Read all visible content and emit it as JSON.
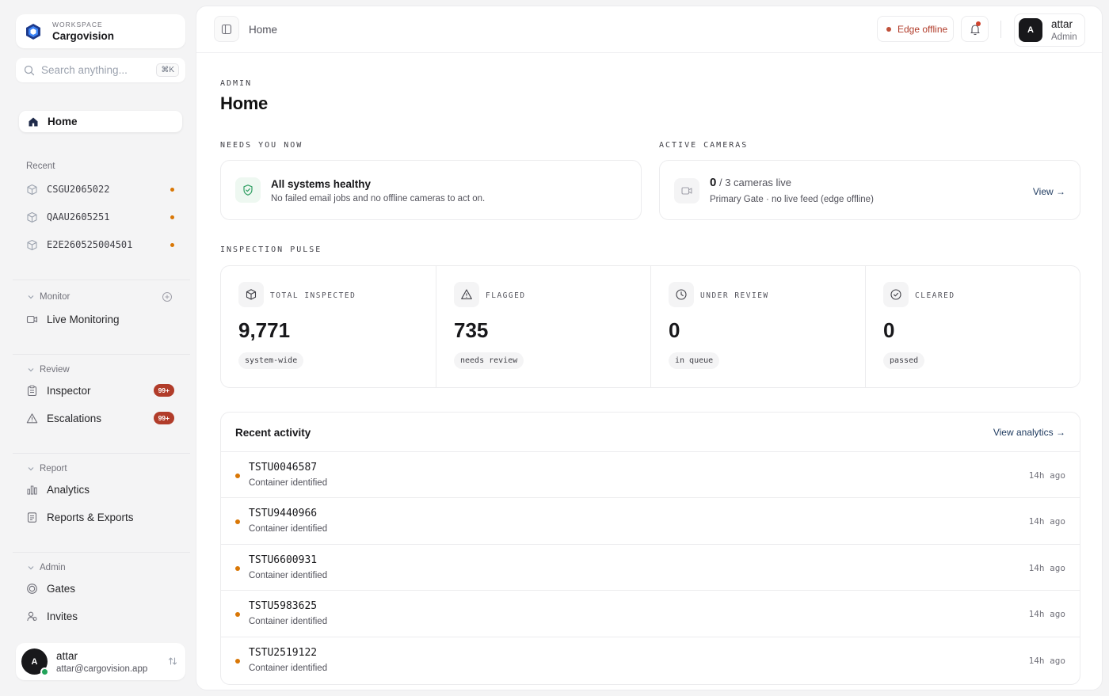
{
  "workspace": {
    "label": "WORKSPACE",
    "name": "Cargovision"
  },
  "search": {
    "placeholder": "Search anything...",
    "shortcut": "⌘K"
  },
  "sidebar": {
    "home_label": "Home",
    "recent_label": "Recent",
    "recent": [
      {
        "id": "CSGU2065022"
      },
      {
        "id": "QAAU2605251"
      },
      {
        "id": "E2E260525004501"
      }
    ],
    "groups": {
      "monitor": {
        "label": "Monitor",
        "items": [
          {
            "label": "Live Monitoring",
            "icon": "video-icon"
          }
        ]
      },
      "review": {
        "label": "Review",
        "items": [
          {
            "label": "Inspector",
            "icon": "clipboard-icon",
            "badge": "99+"
          },
          {
            "label": "Escalations",
            "icon": "warning-icon",
            "badge": "99+"
          }
        ]
      },
      "report": {
        "label": "Report",
        "items": [
          {
            "label": "Analytics",
            "icon": "bar-chart-icon"
          },
          {
            "label": "Reports & Exports",
            "icon": "document-icon"
          }
        ]
      },
      "admin": {
        "label": "Admin",
        "items": [
          {
            "label": "Gates",
            "icon": "gate-icon"
          },
          {
            "label": "Invites",
            "icon": "users-icon"
          }
        ]
      }
    }
  },
  "user": {
    "initial": "A",
    "name": "attar",
    "email": "attar@cargovision.app",
    "role": "Admin"
  },
  "topbar": {
    "breadcrumb": "Home",
    "edge_status": "Edge offline"
  },
  "page": {
    "eyebrow": "ADMIN",
    "title": "Home"
  },
  "needs_you_now": {
    "label": "NEEDS YOU NOW",
    "title": "All systems healthy",
    "subtitle": "No failed email jobs and no offline cameras to act on."
  },
  "active_cameras": {
    "label": "ACTIVE CAMERAS",
    "live_count": "0",
    "total_text": "/ 3 cameras live",
    "gate": "Primary Gate",
    "detail": "· no live feed (edge offline)",
    "link": "View →"
  },
  "inspection_pulse": {
    "label": "INSPECTION PULSE",
    "stats": [
      {
        "label": "TOTAL INSPECTED",
        "value": "9,771",
        "chip": "system-wide",
        "icon": "box-icon"
      },
      {
        "label": "FLAGGED",
        "value": "735",
        "chip": "needs review",
        "icon": "warning-icon"
      },
      {
        "label": "UNDER REVIEW",
        "value": "0",
        "chip": "in queue",
        "icon": "clock-icon"
      },
      {
        "label": "CLEARED",
        "value": "0",
        "chip": "passed",
        "icon": "check-circle-icon"
      }
    ]
  },
  "recent_activity": {
    "title": "Recent activity",
    "link": "View analytics →",
    "rows": [
      {
        "id": "TSTU0046587",
        "desc": "Container identified",
        "time": "14h ago"
      },
      {
        "id": "TSTU9440966",
        "desc": "Container identified",
        "time": "14h ago"
      },
      {
        "id": "TSTU6600931",
        "desc": "Container identified",
        "time": "14h ago"
      },
      {
        "id": "TSTU5983625",
        "desc": "Container identified",
        "time": "14h ago"
      },
      {
        "id": "TSTU2519122",
        "desc": "Container identified",
        "time": "14h ago"
      }
    ]
  },
  "colors": {
    "accent": "#1e3a5f",
    "danger": "#b13c2a",
    "warning_dot": "#d97706",
    "online": "#22a35a"
  }
}
